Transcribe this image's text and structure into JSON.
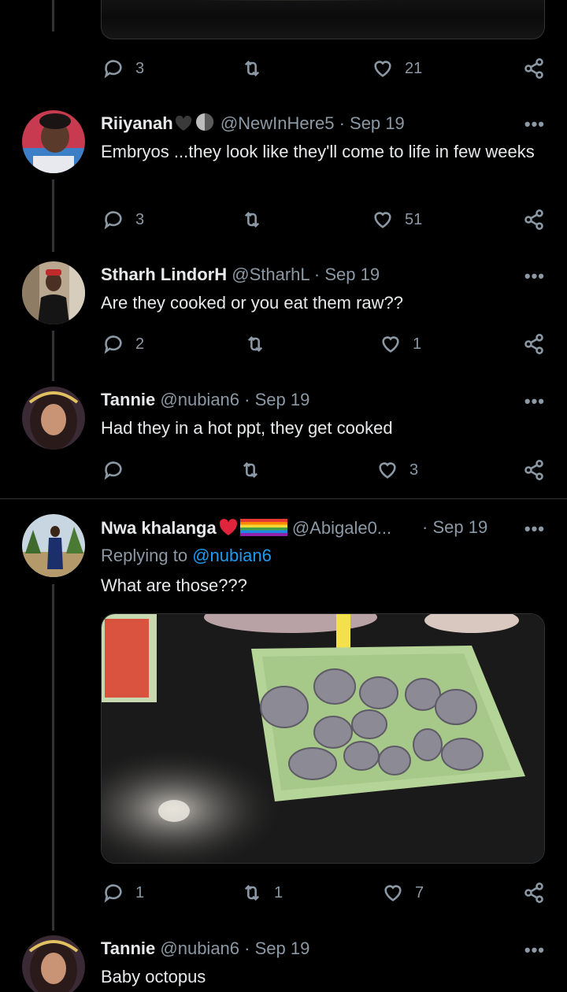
{
  "top_tweet": {
    "actions": {
      "replies": "3",
      "retweets": "",
      "likes": "21"
    }
  },
  "tweets": [
    {
      "name": "Riiyanah",
      "name_emojis": "🖤🌗",
      "handle": "@NewInHere5",
      "date": "Sep 19",
      "text": "Embryos ...they look like they'll come to life in few weeks",
      "actions": {
        "replies": "3",
        "retweets": "",
        "likes": "51"
      }
    },
    {
      "name": "Stharh LindorH",
      "handle": "@StharhL",
      "date": "Sep 19",
      "text": "Are they cooked or you eat them raw??",
      "actions": {
        "replies": "2",
        "retweets": "",
        "likes": "1"
      }
    },
    {
      "name": "Tannie",
      "handle": "@nubian6",
      "date": "Sep 19",
      "text": "Had they in a hot ppt, they get cooked",
      "actions": {
        "replies": "",
        "retweets": "",
        "likes": "3"
      }
    },
    {
      "name": "Nwa khalanga",
      "handle": "@Abigale0...",
      "date": "Sep 19",
      "replying_label": "Replying to",
      "replying_to": "@nubian6",
      "text": "What are those???",
      "actions": {
        "replies": "1",
        "retweets": "1",
        "likes": "7"
      }
    },
    {
      "name": "Tannie",
      "handle": "@nubian6",
      "date": "Sep 19",
      "text": "Baby octopus"
    }
  ],
  "separator": " · ",
  "more_label": "•••",
  "icons": [
    "reply-icon",
    "retweet-icon",
    "like-icon",
    "share-icon",
    "more-icon"
  ],
  "colors": {
    "background": "#000000",
    "secondary_text": "#8b98a5",
    "link": "#1d9bf0",
    "divider": "#2f3336"
  }
}
